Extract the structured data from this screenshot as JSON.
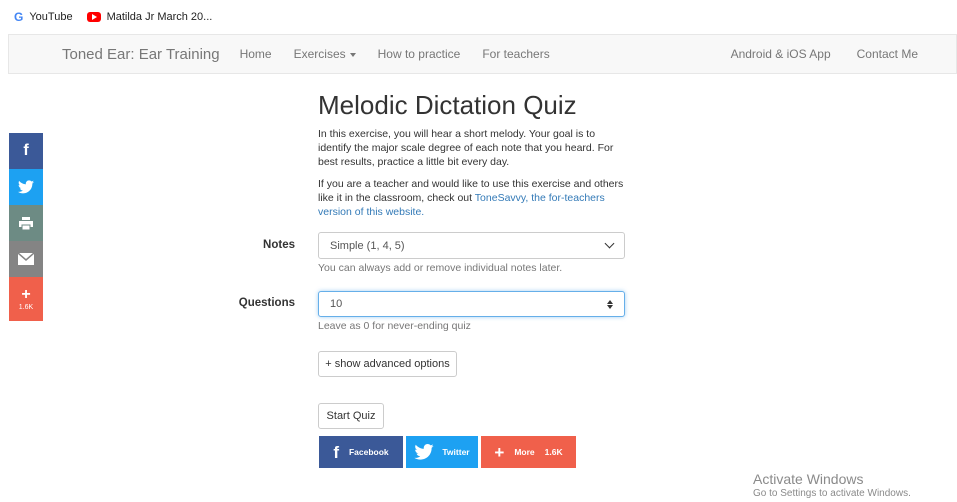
{
  "bookmarks": [
    {
      "icon": "google-icon",
      "label": "YouTube"
    },
    {
      "icon": "youtube-icon",
      "label": "Matilda Jr March 20..."
    }
  ],
  "navbar": {
    "brand": "Toned Ear: Ear Training",
    "links": [
      "Home",
      "Exercises",
      "How to practice",
      "For teachers"
    ],
    "right_links": [
      "Android & iOS App",
      "Contact Me"
    ]
  },
  "share_sidebar": {
    "more_count": "1.6K"
  },
  "main": {
    "title": "Melodic Dictation Quiz",
    "intro1": "In this exercise, you will hear a short melody. Your goal is to identify the major scale degree of each note that you heard. For best results, practice a little bit every day.",
    "intro2_prefix": "If you are a teacher and would like to use this exercise and others like it in the classroom, check out ",
    "intro2_link": "ToneSavvy, the for-teachers version of this website.",
    "notes_label": "Notes",
    "notes_value": "Simple (1, 4, 5)",
    "notes_help": "You can always add or remove individual notes later.",
    "questions_label": "Questions",
    "questions_value": "10",
    "questions_help": "Leave as 0 for never-ending quiz",
    "advanced_label": "+ show advanced options",
    "start_label": "Start Quiz"
  },
  "share_bar": {
    "facebook": "Facebook",
    "twitter": "Twitter",
    "more": "More",
    "more_count": "1.6K"
  },
  "watermark": {
    "line1": "Activate Windows",
    "line2": "Go to Settings to activate Windows."
  },
  "colors": {
    "facebook": "#3b5998",
    "twitter": "#1da1f2",
    "print": "#6d8b84",
    "email": "#848484",
    "more": "#f0604b",
    "link": "#337ab7"
  }
}
